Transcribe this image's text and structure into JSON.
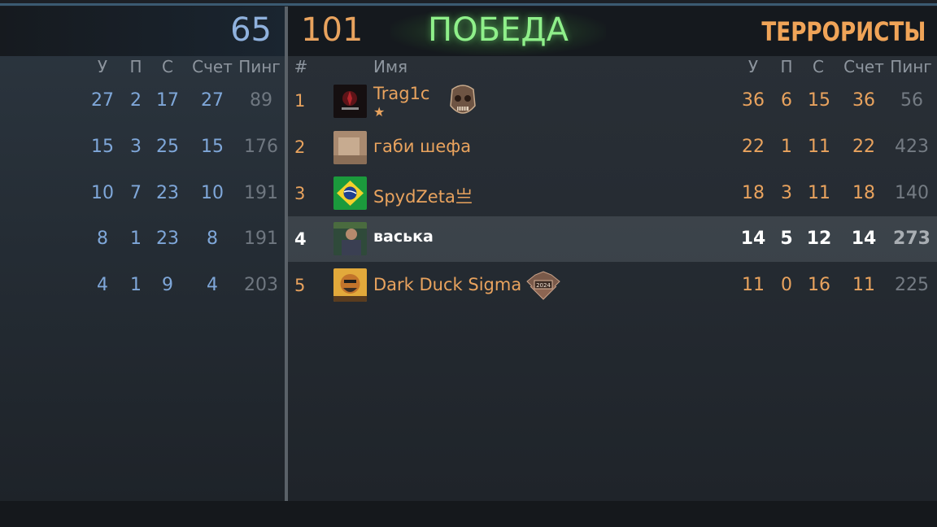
{
  "score": {
    "ct": "65",
    "t": "101",
    "result": "ПОБЕДА",
    "team_name": "ТЕРРОРИСТЫ"
  },
  "left_headers": {
    "k": "У",
    "d": "П",
    "a": "С",
    "score": "Счет",
    "ping": "Пинг"
  },
  "right_headers": {
    "num": "#",
    "name": "Имя",
    "k": "У",
    "d": "П",
    "a": "С",
    "score": "Счет",
    "ping": "Пинг"
  },
  "left_rows": [
    {
      "k": "27",
      "d": "2",
      "a": "17",
      "score": "27",
      "ping": "89"
    },
    {
      "k": "15",
      "d": "3",
      "a": "25",
      "score": "15",
      "ping": "176"
    },
    {
      "k": "10",
      "d": "7",
      "a": "23",
      "score": "10",
      "ping": "191"
    },
    {
      "k": "8",
      "d": "1",
      "a": "23",
      "score": "8",
      "ping": "191"
    },
    {
      "k": "4",
      "d": "1",
      "a": "9",
      "score": "4",
      "ping": "203"
    }
  ],
  "right_rows": [
    {
      "num": "1",
      "name": "Trag1c",
      "sub": "★",
      "k": "36",
      "d": "6",
      "a": "15",
      "score": "36",
      "ping": "56",
      "avatar_icon": "tragic-logo-avatar",
      "badge_icon": "skull-badge-icon"
    },
    {
      "num": "2",
      "name": "габи шефа",
      "sub": "",
      "k": "22",
      "d": "1",
      "a": "11",
      "score": "22",
      "ping": "423",
      "avatar_icon": "photo-avatar",
      "badge_icon": ""
    },
    {
      "num": "3",
      "name": "SpydZeta亗",
      "sub": "",
      "k": "18",
      "d": "3",
      "a": "11",
      "score": "18",
      "ping": "140",
      "avatar_icon": "brazil-flag-avatar",
      "badge_icon": ""
    },
    {
      "num": "4",
      "name": "васька",
      "sub": "",
      "k": "14",
      "d": "5",
      "a": "12",
      "score": "14",
      "ping": "273",
      "avatar_icon": "player-photo-avatar",
      "badge_icon": "",
      "highlight": true
    },
    {
      "num": "5",
      "name": "Dark Duck Sigma",
      "sub": "",
      "k": "11",
      "d": "0",
      "a": "16",
      "score": "11",
      "ping": "225",
      "avatar_icon": "duck-character-avatar",
      "badge_icon": "2024-medal-badge-icon",
      "badge_text": "2024"
    }
  ],
  "colors": {
    "ct_blue": "#8fb1dd",
    "t_orange": "#e9a35e",
    "win_green": "#8ff08a"
  }
}
